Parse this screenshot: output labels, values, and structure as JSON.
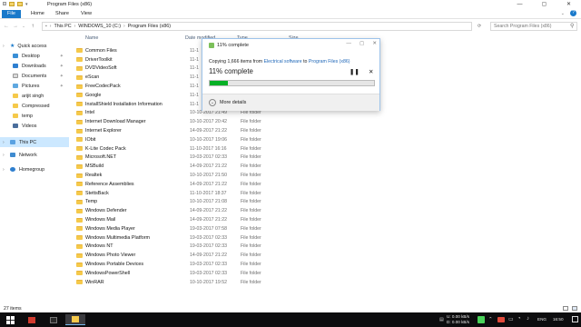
{
  "window": {
    "title": "Program Files (x86)",
    "min_glyph": "—",
    "max_glyph": "▢",
    "close_glyph": "✕"
  },
  "ribbon": {
    "tabs": [
      "File",
      "Home",
      "Share",
      "View"
    ]
  },
  "address": {
    "crumbs": [
      "This PC",
      "WINDOWS_10 (C:)",
      "Program Files (x86)"
    ],
    "search_placeholder": "Search Program Files (x86)"
  },
  "sidebar": {
    "items": [
      {
        "label": "Quick access",
        "icon": "star-icon",
        "pinned": false
      },
      {
        "label": "Desktop",
        "icon": "desktop-icon",
        "pinned": true
      },
      {
        "label": "Downloads",
        "icon": "downloads-icon",
        "pinned": true
      },
      {
        "label": "Documents",
        "icon": "documents-icon",
        "pinned": true
      },
      {
        "label": "Pictures",
        "icon": "pictures-icon",
        "pinned": true
      },
      {
        "label": "arijit singh",
        "icon": "folder-icon",
        "pinned": false
      },
      {
        "label": "Compressed",
        "icon": "folder-icon",
        "pinned": false
      },
      {
        "label": "temp",
        "icon": "folder-icon",
        "pinned": false
      },
      {
        "label": "Videos",
        "icon": "videos-icon",
        "pinned": false
      },
      {
        "label": "This PC",
        "icon": "computer-icon",
        "pinned": false,
        "selected": true
      },
      {
        "label": "Network",
        "icon": "network-icon",
        "pinned": false
      },
      {
        "label": "Homegroup",
        "icon": "homegroup-icon",
        "pinned": false
      }
    ],
    "pin_glyph": "📌"
  },
  "list": {
    "columns": [
      "Name",
      "Date modified",
      "Type",
      "Size"
    ],
    "rows": [
      {
        "name": "Common Files",
        "date": "11-1",
        "type": ""
      },
      {
        "name": "DriverToolkit",
        "date": "11-1",
        "type": ""
      },
      {
        "name": "DVDVideoSoft",
        "date": "11-1",
        "type": ""
      },
      {
        "name": "eScan",
        "date": "11-1",
        "type": ""
      },
      {
        "name": "FreeCodecPack",
        "date": "11-1",
        "type": ""
      },
      {
        "name": "Google",
        "date": "11-1",
        "type": ""
      },
      {
        "name": "InstallShield Installation Information",
        "date": "11-1",
        "type": ""
      },
      {
        "name": "Intel",
        "date": "10-10-2017 21:49",
        "type": "File folder"
      },
      {
        "name": "Internet Download Manager",
        "date": "10-10-2017 20:42",
        "type": "File folder"
      },
      {
        "name": "Internet Explorer",
        "date": "14-09-2017 21:22",
        "type": "File folder"
      },
      {
        "name": "IObit",
        "date": "10-10-2017 19:06",
        "type": "File folder"
      },
      {
        "name": "K-Lite Codec Pack",
        "date": "11-10-2017 16:16",
        "type": "File folder"
      },
      {
        "name": "Microsoft.NET",
        "date": "19-03-2017 02:33",
        "type": "File folder"
      },
      {
        "name": "MSBuild",
        "date": "14-09-2017 21:22",
        "type": "File folder"
      },
      {
        "name": "Realtek",
        "date": "10-10-2017 21:50",
        "type": "File folder"
      },
      {
        "name": "Reference Assemblies",
        "date": "14-09-2017 21:22",
        "type": "File folder"
      },
      {
        "name": "StettsBack",
        "date": "11-10-2017 18:37",
        "type": "File folder"
      },
      {
        "name": "Temp",
        "date": "10-10-2017 21:08",
        "type": "File folder"
      },
      {
        "name": "Windows Defender",
        "date": "14-09-2017 21:22",
        "type": "File folder"
      },
      {
        "name": "Windows Mail",
        "date": "14-09-2017 21:22",
        "type": "File folder"
      },
      {
        "name": "Windows Media Player",
        "date": "19-03-2017 07:58",
        "type": "File folder"
      },
      {
        "name": "Windows Multimedia Platform",
        "date": "19-03-2017 02:33",
        "type": "File folder"
      },
      {
        "name": "Windows NT",
        "date": "19-03-2017 02:33",
        "type": "File folder"
      },
      {
        "name": "Windows Photo Viewer",
        "date": "14-09-2017 21:22",
        "type": "File folder"
      },
      {
        "name": "Windows Portable Devices",
        "date": "19-03-2017 02:33",
        "type": "File folder"
      },
      {
        "name": "WindowsPowerShell",
        "date": "19-03-2017 02:33",
        "type": "File folder"
      },
      {
        "name": "WinRAR",
        "date": "10-10-2017 19:52",
        "type": "File folder"
      }
    ]
  },
  "status": {
    "items_text": "27 items"
  },
  "dialog": {
    "title": "11% complete",
    "copy_prefix": "Copying 1,666 items from",
    "copy_source": "Electrical software",
    "copy_to": "to",
    "copy_dest": "Program Files (x86)",
    "big_text": "11% complete",
    "progress": 0.11,
    "pause_glyph": "❚❚",
    "cancel_glyph": "✕",
    "details_label": "More details",
    "details_glyph": "⌄"
  },
  "taskbar": {
    "upload_rate": "0.00 kB/s",
    "download_rate": "0.00 kB/s",
    "upload_label": "U:",
    "download_label": "D:",
    "time": "16:50",
    "lang": "ENG"
  },
  "colors": {
    "accent": "#1979ca",
    "progress": "#06b025",
    "selection": "#cce8ff",
    "link": "#1f67b8"
  }
}
